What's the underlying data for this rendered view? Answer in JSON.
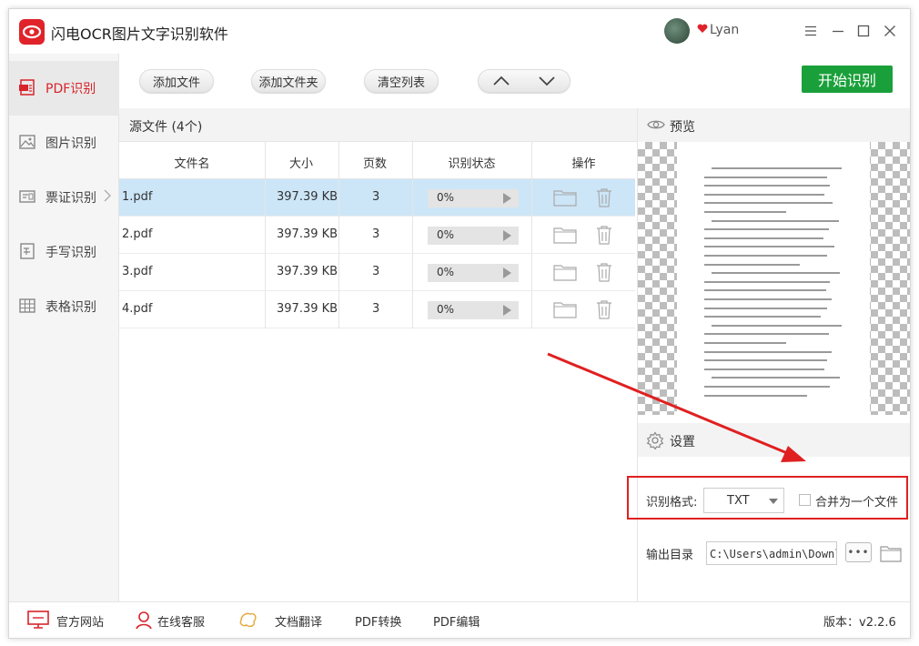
{
  "app": {
    "title": "闪电OCR图片文字识别软件",
    "user": "Lyan"
  },
  "sidebar": {
    "items": [
      {
        "label": "PDF识别",
        "icon": "pdf-icon",
        "active": true
      },
      {
        "label": "图片识别",
        "icon": "image-icon"
      },
      {
        "label": "票证识别",
        "icon": "ticket-icon"
      },
      {
        "label": "手写识别",
        "icon": "handwriting-icon"
      },
      {
        "label": "表格识别",
        "icon": "table-icon"
      }
    ]
  },
  "toolbar": {
    "add_file": "添加文件",
    "add_folder": "添加文件夹",
    "clear_list": "清空列表",
    "start": "开始识别"
  },
  "filelist": {
    "title": "源文件 (4个)",
    "columns": [
      "文件名",
      "大小",
      "页数",
      "识别状态",
      "操作"
    ],
    "rows": [
      {
        "name": "1.pdf",
        "size": "397.39 KB",
        "pages": "3",
        "progress": "0%",
        "selected": true
      },
      {
        "name": "2.pdf",
        "size": "397.39 KB",
        "pages": "3",
        "progress": "0%"
      },
      {
        "name": "3.pdf",
        "size": "397.39 KB",
        "pages": "3",
        "progress": "0%"
      },
      {
        "name": "4.pdf",
        "size": "397.39 KB",
        "pages": "3",
        "progress": "0%"
      }
    ]
  },
  "preview": {
    "title": "预览"
  },
  "settings": {
    "title": "设置",
    "format_label": "识别格式:",
    "format_value": "TXT",
    "merge_label": "合并为一个文件",
    "output_label": "输出目录",
    "output_value": "C:\\Users\\admin\\Downloads",
    "more": "•••"
  },
  "footer": {
    "links": [
      "官方网站",
      "在线客服",
      "文档翻译",
      "PDF转换",
      "PDF编辑"
    ],
    "version": "版本：v2.2.6"
  },
  "colors": {
    "accent_red": "#d9232a",
    "start_green": "#1aa03a",
    "selected_row": "#cce6f8",
    "annotation_red": "#e02020"
  }
}
